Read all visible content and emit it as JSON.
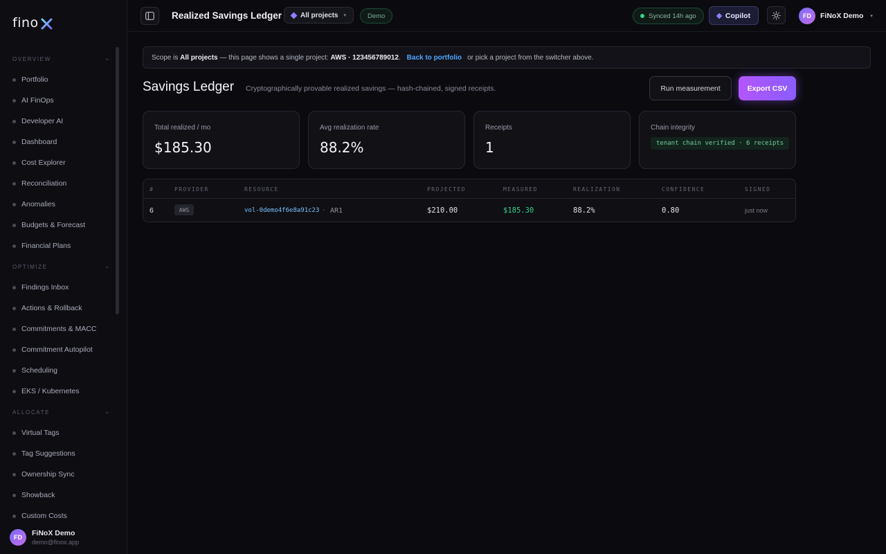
{
  "brand": {
    "name": "fino",
    "mark": "X"
  },
  "sidebar": {
    "sections": [
      {
        "label": "OVERVIEW",
        "items": [
          "Portfolio",
          "AI FinOps",
          "Developer AI",
          "Dashboard",
          "Cost Explorer",
          "Reconciliation",
          "Anomalies",
          "Budgets & Forecast",
          "Financial Plans"
        ]
      },
      {
        "label": "OPTIMIZE",
        "items": [
          "Findings Inbox",
          "Actions & Rollback",
          "Commitments & MACC",
          "Commitment Autopilot",
          "Scheduling",
          "EKS / Kubernetes"
        ]
      },
      {
        "label": "ALLOCATE",
        "items": [
          "Virtual Tags",
          "Tag Suggestions",
          "Ownership Sync",
          "Showback",
          "Custom Costs"
        ]
      }
    ],
    "user": {
      "initials": "FD",
      "name": "FiNoX Demo",
      "email": "demo@finox.app"
    }
  },
  "topbar": {
    "title": "Realized Savings Ledger",
    "project_switcher": "All projects",
    "demo_badge": "Demo",
    "sync_status": "Synced 14h ago",
    "copilot": "Copilot",
    "user": {
      "initials": "FD",
      "name": "FiNoX Demo"
    }
  },
  "banner": {
    "prefix": "Scope is ",
    "scope": "All projects",
    "middle": " — this page shows a single project: ",
    "project": "AWS · 123456789012",
    "period": ".",
    "link": "Back to portfolio",
    "suffix": "or pick a project from the switcher above."
  },
  "page": {
    "heading": "Savings Ledger",
    "subtitle": "Cryptographically provable realized savings — hash-chained, signed receipts.",
    "run_button": "Run measurement",
    "export_button": "Export CSV"
  },
  "stats": [
    {
      "label": "Total realized / mo",
      "value": "$185.30"
    },
    {
      "label": "Avg realization rate",
      "value": "88.2%"
    },
    {
      "label": "Receipts",
      "value": "1"
    }
  ],
  "chain": {
    "label": "Chain integrity",
    "status": "tenant chain verified · 6 receipts"
  },
  "table": {
    "columns": [
      "#",
      "PROVIDER",
      "RESOURCE",
      "PROJECTED",
      "MEASURED",
      "REALIZATION",
      "CONFIDENCE",
      "SIGNED"
    ],
    "rows": [
      {
        "num": "6",
        "provider": "AWS",
        "resource": "vol-0demo4f6e8a91c23",
        "separator": "·",
        "kind": "AR1",
        "projected": "$210.00",
        "measured": "$185.30",
        "realization": "88.2%",
        "confidence": "0.80",
        "signed": "just now"
      }
    ]
  },
  "colors": {
    "accent": "#8a5cff",
    "link": "#4fa8ff",
    "positive": "#35d28a"
  },
  "icons": [
    "sidebar-toggle-icon",
    "diamond-icon",
    "sun-icon",
    "chevron-down-icon"
  ]
}
